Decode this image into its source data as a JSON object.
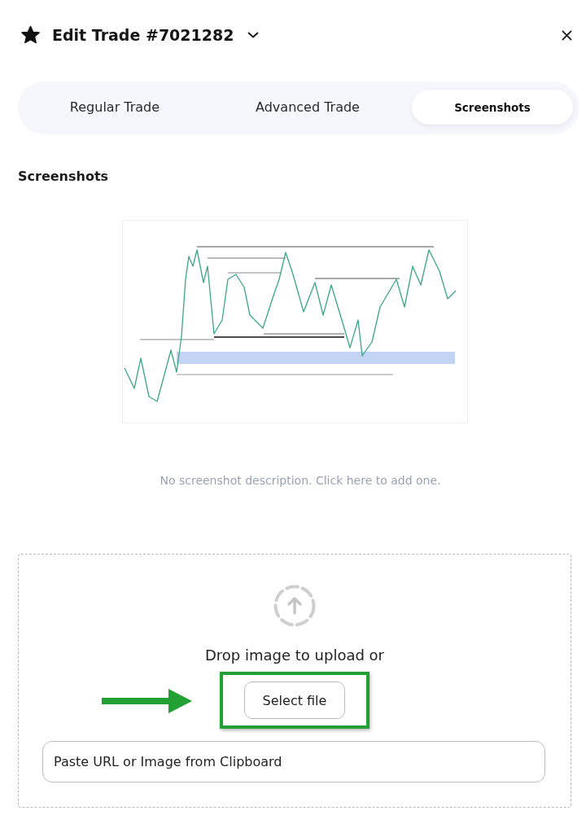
{
  "header": {
    "title": "Edit Trade #7021282",
    "starred": true
  },
  "tabs": [
    {
      "label": "Regular Trade",
      "selected": false
    },
    {
      "label": "Advanced Trade",
      "selected": false
    },
    {
      "label": "Screenshots",
      "selected": true
    }
  ],
  "section": {
    "title": "Screenshots"
  },
  "screenshots": [
    {
      "description": "No screenshot description. Click here to add one."
    }
  ],
  "upload": {
    "prompt": "Drop image to upload or",
    "button": "Select file",
    "url_field": {
      "placeholder": "Paste URL or Image from Clipboard"
    }
  }
}
